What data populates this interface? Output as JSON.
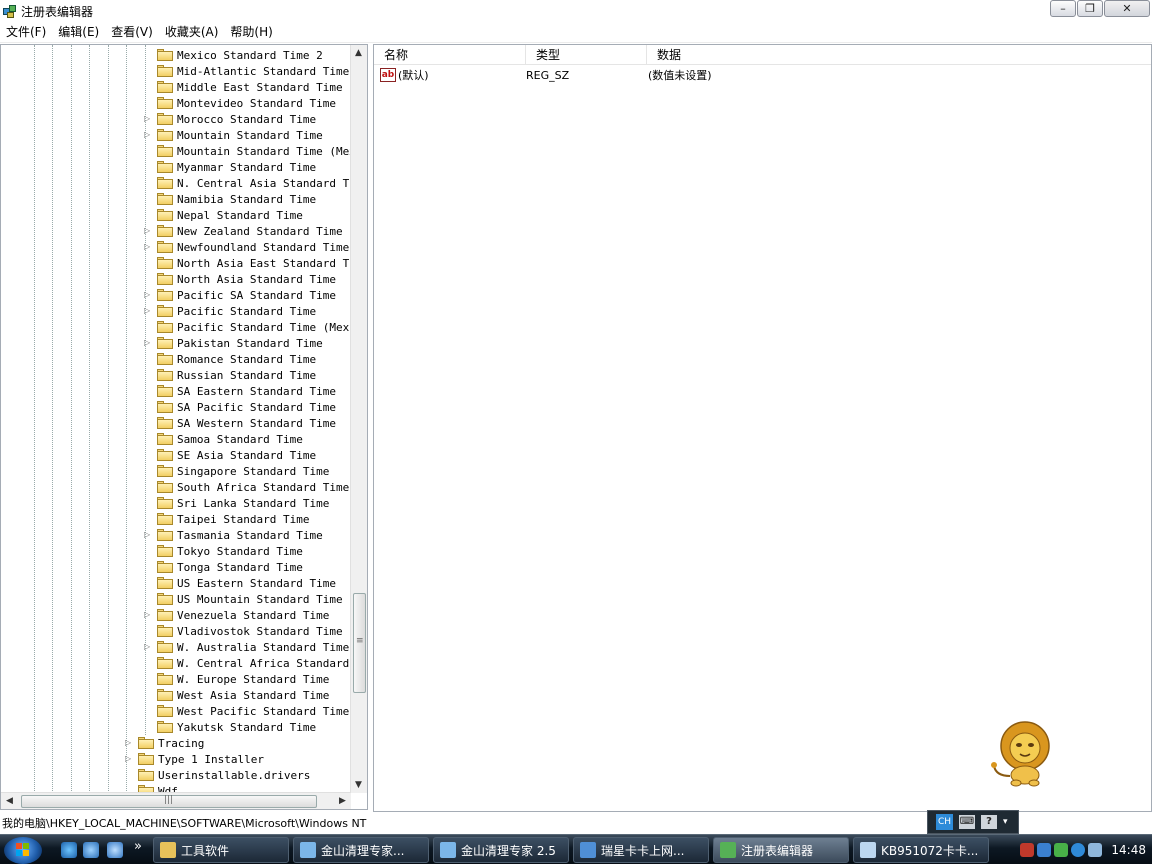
{
  "window": {
    "title": "注册表编辑器"
  },
  "menu": [
    "文件(F)",
    "编辑(E)",
    "查看(V)",
    "收藏夹(A)",
    "帮助(H)"
  ],
  "tree": {
    "items": [
      {
        "label": "Mexico Standard Time 2",
        "exp": false,
        "lvl": 2
      },
      {
        "label": "Mid-Atlantic Standard Time",
        "exp": false,
        "lvl": 2
      },
      {
        "label": "Middle East Standard Time",
        "exp": false,
        "lvl": 2
      },
      {
        "label": "Montevideo Standard Time",
        "exp": false,
        "lvl": 2
      },
      {
        "label": "Morocco Standard Time",
        "exp": true,
        "lvl": 2
      },
      {
        "label": "Mountain Standard Time",
        "exp": true,
        "lvl": 2
      },
      {
        "label": "Mountain Standard Time (Mexico)",
        "exp": false,
        "lvl": 2
      },
      {
        "label": "Myanmar Standard Time",
        "exp": false,
        "lvl": 2
      },
      {
        "label": "N. Central Asia Standard Time",
        "exp": false,
        "lvl": 2
      },
      {
        "label": "Namibia Standard Time",
        "exp": false,
        "lvl": 2
      },
      {
        "label": "Nepal Standard Time",
        "exp": false,
        "lvl": 2
      },
      {
        "label": "New Zealand Standard Time",
        "exp": true,
        "lvl": 2
      },
      {
        "label": "Newfoundland Standard Time",
        "exp": true,
        "lvl": 2
      },
      {
        "label": "North Asia East Standard Time",
        "exp": false,
        "lvl": 2
      },
      {
        "label": "North Asia Standard Time",
        "exp": false,
        "lvl": 2
      },
      {
        "label": "Pacific SA Standard Time",
        "exp": true,
        "lvl": 2
      },
      {
        "label": "Pacific Standard Time",
        "exp": true,
        "lvl": 2
      },
      {
        "label": "Pacific Standard Time (Mexico)",
        "exp": false,
        "lvl": 2
      },
      {
        "label": "Pakistan Standard Time",
        "exp": true,
        "lvl": 2
      },
      {
        "label": "Romance Standard Time",
        "exp": false,
        "lvl": 2
      },
      {
        "label": "Russian Standard Time",
        "exp": false,
        "lvl": 2
      },
      {
        "label": "SA Eastern Standard Time",
        "exp": false,
        "lvl": 2
      },
      {
        "label": "SA Pacific Standard Time",
        "exp": false,
        "lvl": 2
      },
      {
        "label": "SA Western Standard Time",
        "exp": false,
        "lvl": 2
      },
      {
        "label": "Samoa Standard Time",
        "exp": false,
        "lvl": 2
      },
      {
        "label": "SE Asia Standard Time",
        "exp": false,
        "lvl": 2
      },
      {
        "label": "Singapore Standard Time",
        "exp": false,
        "lvl": 2
      },
      {
        "label": "South Africa Standard Time",
        "exp": false,
        "lvl": 2
      },
      {
        "label": "Sri Lanka Standard Time",
        "exp": false,
        "lvl": 2
      },
      {
        "label": "Taipei Standard Time",
        "exp": false,
        "lvl": 2
      },
      {
        "label": "Tasmania Standard Time",
        "exp": true,
        "lvl": 2
      },
      {
        "label": "Tokyo Standard Time",
        "exp": false,
        "lvl": 2
      },
      {
        "label": "Tonga Standard Time",
        "exp": false,
        "lvl": 2
      },
      {
        "label": "US Eastern Standard Time",
        "exp": false,
        "lvl": 2
      },
      {
        "label": "US Mountain Standard Time",
        "exp": false,
        "lvl": 2
      },
      {
        "label": "Venezuela Standard Time",
        "exp": true,
        "lvl": 2
      },
      {
        "label": "Vladivostok Standard Time",
        "exp": false,
        "lvl": 2
      },
      {
        "label": "W. Australia Standard Time",
        "exp": true,
        "lvl": 2
      },
      {
        "label": "W. Central Africa Standard Time",
        "exp": false,
        "lvl": 2
      },
      {
        "label": "W. Europe Standard Time",
        "exp": false,
        "lvl": 2
      },
      {
        "label": "West Asia Standard Time",
        "exp": false,
        "lvl": 2
      },
      {
        "label": "West Pacific Standard Time",
        "exp": false,
        "lvl": 2
      },
      {
        "label": "Yakutsk Standard Time",
        "exp": false,
        "lvl": 2
      },
      {
        "label": "Tracing",
        "exp": true,
        "lvl": 1
      },
      {
        "label": "Type 1 Installer",
        "exp": true,
        "lvl": 1
      },
      {
        "label": "Userinstallable.drivers",
        "exp": false,
        "lvl": 1
      },
      {
        "label": "Wdf",
        "exp": false,
        "lvl": 1
      }
    ]
  },
  "list": {
    "columns": [
      "名称",
      "类型",
      "数据"
    ],
    "rows": [
      {
        "icon": "ab",
        "name": "(默认)",
        "type": "REG_SZ",
        "data": "(数值未设置)"
      }
    ]
  },
  "status": {
    "path": "我的电脑\\HKEY_LOCAL_MACHINE\\SOFTWARE\\Microsoft\\Windows NT"
  },
  "langbar": {
    "ch": "CH"
  },
  "taskbar": {
    "quicklaunch_more": "»",
    "buttons": [
      {
        "label": "工具软件",
        "active": false
      },
      {
        "label": "金山清理专家...",
        "active": false
      },
      {
        "label": "金山清理专家 2.5",
        "active": false
      },
      {
        "label": "瑞星卡卡上网...",
        "active": false
      },
      {
        "label": "注册表编辑器",
        "active": true
      },
      {
        "label": "KB951072卡卡...",
        "active": false
      }
    ],
    "clock": "14:48"
  },
  "colors": {
    "accent": "#2d8bd9",
    "taskbar": "#0d1823"
  }
}
